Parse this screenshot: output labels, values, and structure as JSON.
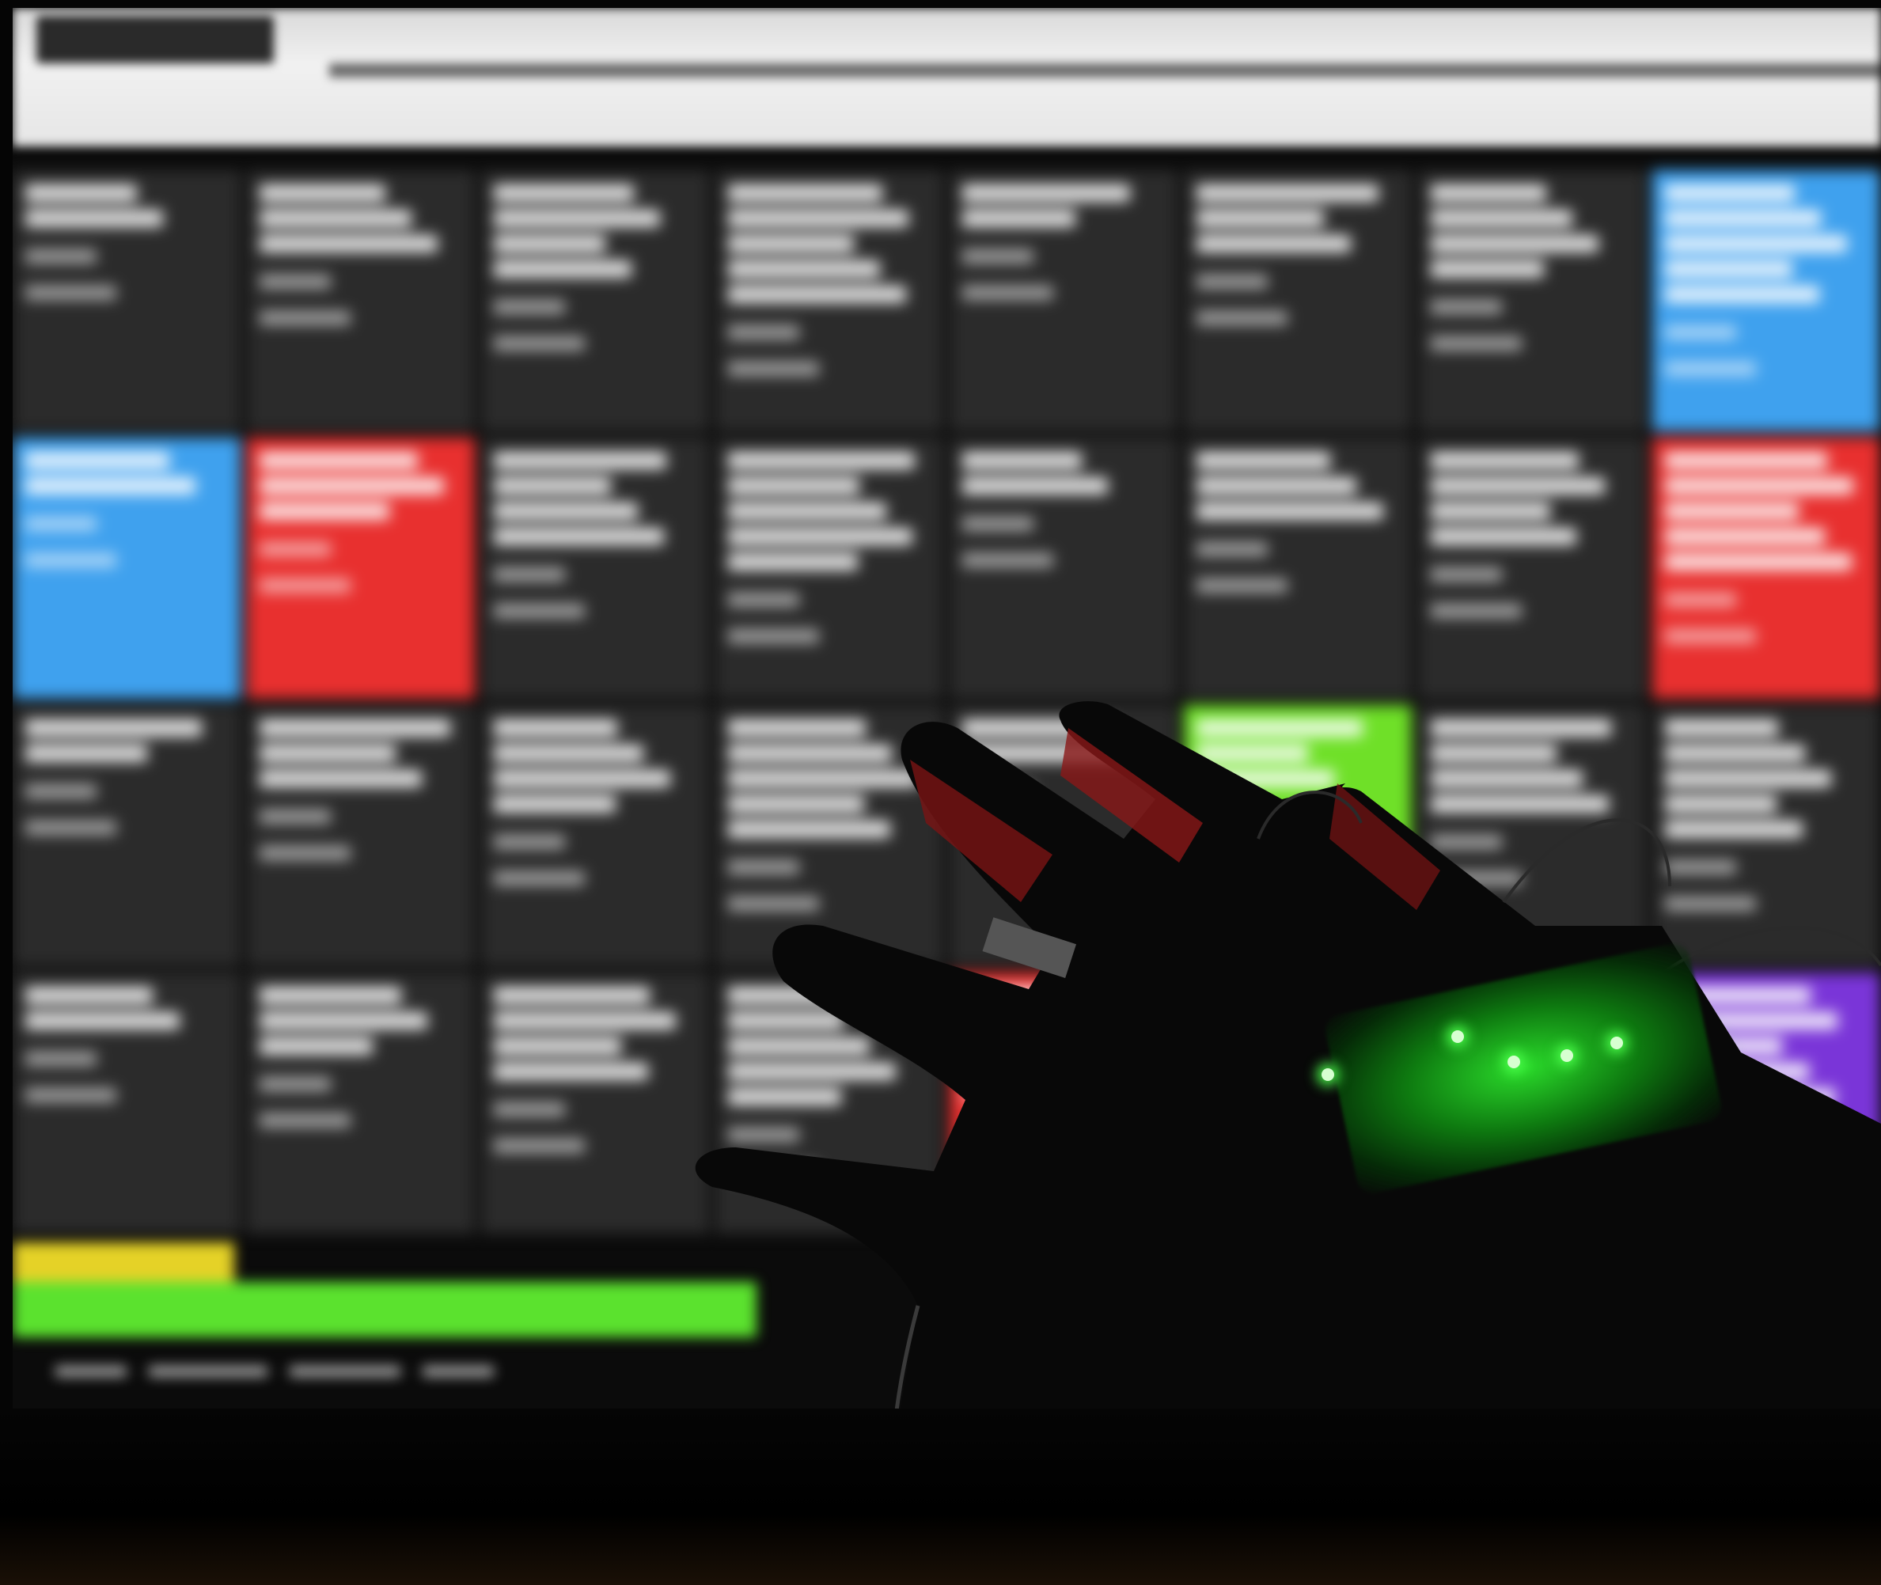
{
  "scene": {
    "description_colors": {
      "tile_dark": "#2b2b2b",
      "tile_blue": "#3fa1ee",
      "tile_red": "#e8302f",
      "tile_green": "#6fe028",
      "tile_purple": "#7a35d8",
      "footer_yellow": "#e5d227",
      "footer_green": "#5be22e",
      "led_glow": "#2bdb2b"
    }
  },
  "monitor": {
    "tiles": [
      {
        "color": "dark"
      },
      {
        "color": "dark"
      },
      {
        "color": "dark"
      },
      {
        "color": "dark"
      },
      {
        "color": "dark"
      },
      {
        "color": "dark"
      },
      {
        "color": "dark"
      },
      {
        "color": "blue"
      },
      {
        "color": "blue"
      },
      {
        "color": "red"
      },
      {
        "color": "dark"
      },
      {
        "color": "dark"
      },
      {
        "color": "dark"
      },
      {
        "color": "dark"
      },
      {
        "color": "dark"
      },
      {
        "color": "red"
      },
      {
        "color": "dark"
      },
      {
        "color": "dark"
      },
      {
        "color": "dark"
      },
      {
        "color": "dark"
      },
      {
        "color": "dark"
      },
      {
        "color": "green"
      },
      {
        "color": "dark"
      },
      {
        "color": "dark"
      },
      {
        "color": "dark"
      },
      {
        "color": "dark"
      },
      {
        "color": "dark"
      },
      {
        "color": "dark"
      },
      {
        "color": "red"
      },
      {
        "color": "dark"
      },
      {
        "color": "blue"
      },
      {
        "color": "purple"
      }
    ]
  }
}
